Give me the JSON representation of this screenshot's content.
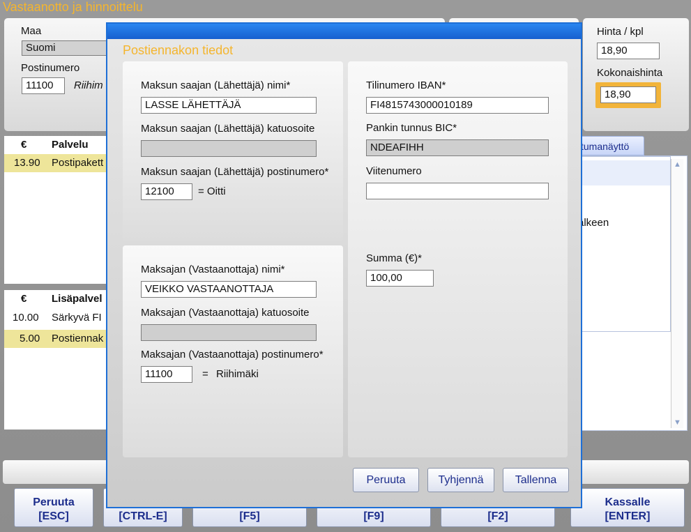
{
  "window_title": "Vastaanotto ja hinnoittelu",
  "background": {
    "maa_label": "Maa",
    "maa_value": "Suomi",
    "postinumero_label": "Postinumero",
    "postinumero_value": "11100",
    "city_partial": "Riihim",
    "hinta_label": "Hinta / kpl",
    "hinta_value": "18,90",
    "kokonaishinta_label": "Kokonaishinta",
    "kokonaishinta_value": "18,90",
    "tab_label": "tumanäyttö",
    "side_text": "älkeen",
    "services_table": {
      "headers": [
        "€",
        "Palvelu"
      ],
      "rows": [
        [
          "13.90",
          "Postipakett"
        ]
      ]
    },
    "extras_table": {
      "headers": [
        "€",
        "Lisäpalvel"
      ],
      "rows": [
        [
          "10.00",
          "Särkyvä FI"
        ],
        [
          "5.00",
          "Postiennak"
        ]
      ]
    }
  },
  "fkeys": [
    {
      "line1": "Peruuta",
      "line2": "[ESC]"
    },
    {
      "line1": "",
      "line2": "[CTRL-E]"
    },
    {
      "line1": "",
      "line2": "[F5]"
    },
    {
      "line1": "",
      "line2": "[F9]"
    },
    {
      "line1": "",
      "line2": "[F2]"
    },
    {
      "line1": "Kassalle",
      "line2": "[ENTER]"
    }
  ],
  "dialog": {
    "title": "Postiennakon tiedot",
    "sender": {
      "name_label": "Maksun saajan (Lähettäjä) nimi*",
      "name_value": "LASSE LÄHETTÄJÄ",
      "street_label": "Maksun saajan (Lähettäjä) katuosoite",
      "street_value": "",
      "zip_label": "Maksun saajan (Lähettäjä) postinumero*",
      "zip_value": "12100",
      "city_text": "= Oitti"
    },
    "payer": {
      "name_label": "Maksajan (Vastaanottaja) nimi*",
      "name_value": "VEIKKO VASTAANOTTAJA",
      "street_label": "Maksajan (Vastaanottaja) katuosoite",
      "street_value": "",
      "zip_label": "Maksajan (Vastaanottaja) postinumero*",
      "zip_value": "11100",
      "city_eq": "=",
      "city_text": "Riihimäki"
    },
    "bank": {
      "iban_label": "Tilinumero IBAN*",
      "iban_value": "FI4815743000010189",
      "bic_label": "Pankin tunnus BIC*",
      "bic_value": "NDEAFIHH",
      "ref_label": "Viitenumero",
      "ref_value": "",
      "sum_label": "Summa (€)*",
      "sum_value": "100,00"
    },
    "buttons": {
      "cancel": "Peruuta",
      "clear": "Tyhjennä",
      "save": "Tallenna"
    }
  }
}
